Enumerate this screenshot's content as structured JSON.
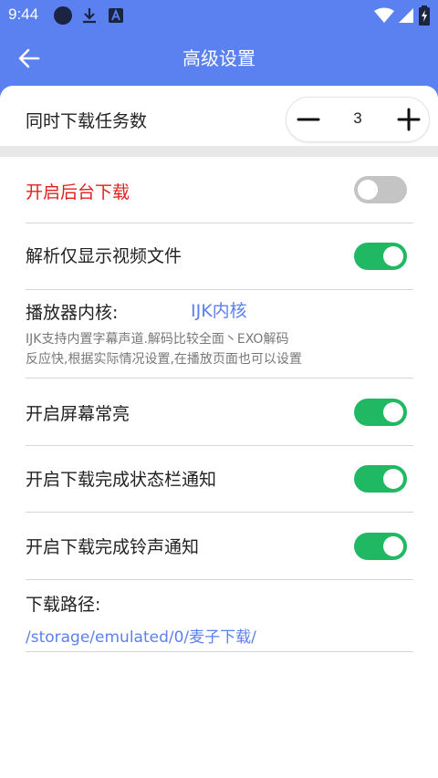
{
  "status_bar": {
    "time": "9:44",
    "icons": [
      "circle-icon",
      "download-icon",
      "a-app-icon"
    ],
    "right_icons": [
      "wifi-icon",
      "signal-icon",
      "battery-icon"
    ]
  },
  "app_bar": {
    "back_icon": "arrow-left-icon",
    "title": "高级设置"
  },
  "concurrent_tasks": {
    "label": "同时下载任务数",
    "value": "3",
    "minus_icon": "minus-icon",
    "plus_icon": "plus-icon"
  },
  "settings": {
    "background_download": {
      "label": "开启后台下载",
      "enabled": false,
      "color": "#e02020"
    },
    "show_video_only": {
      "label": "解析仅显示视频文件",
      "enabled": true
    },
    "player_core": {
      "label": "播放器内核:",
      "value": "IJK内核",
      "desc_line1": "IJK支持内置字幕声道.解码比较全面丶EXO解码",
      "desc_line2": "反应快,根据实际情况设置,在播放页面也可以设置"
    },
    "screen_on": {
      "label": "开启屏幕常亮",
      "enabled": true
    },
    "statusbar_notify": {
      "label": "开启下载完成状态栏通知",
      "enabled": true
    },
    "ringtone_notify": {
      "label": "开启下载完成铃声通知",
      "enabled": true
    },
    "download_path": {
      "label": "下载路径:",
      "value": "/storage/emulated/0/麦子下载/"
    }
  },
  "colors": {
    "primary": "#5b80f0",
    "toggle_on": "#21b863",
    "toggle_off": "#c4c4c4",
    "warning_text": "#e02020"
  }
}
